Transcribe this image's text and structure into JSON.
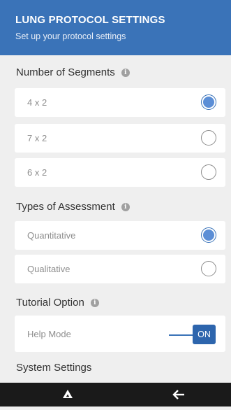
{
  "header": {
    "title": "LUNG PROTOCOL SETTINGS",
    "subtitle": "Set up your protocol settings",
    "color": "#3a73b8"
  },
  "segments": {
    "label": "Number of Segments",
    "options": [
      {
        "label": "4 x 2",
        "selected": true
      },
      {
        "label": "7 x 2",
        "selected": false
      },
      {
        "label": "6 x 2",
        "selected": false
      }
    ]
  },
  "assessment": {
    "label": "Types of Assessment",
    "options": [
      {
        "label": "Quantitative",
        "selected": true
      },
      {
        "label": "Qualitative",
        "selected": false
      }
    ]
  },
  "tutorial": {
    "label": "Tutorial Option",
    "help_mode": {
      "label": "Help Mode",
      "state": "ON"
    }
  },
  "system": {
    "label": "System Settings"
  },
  "navbar": {
    "home_icon": "home-triangle-icon",
    "back_icon": "back-arrow-icon"
  }
}
